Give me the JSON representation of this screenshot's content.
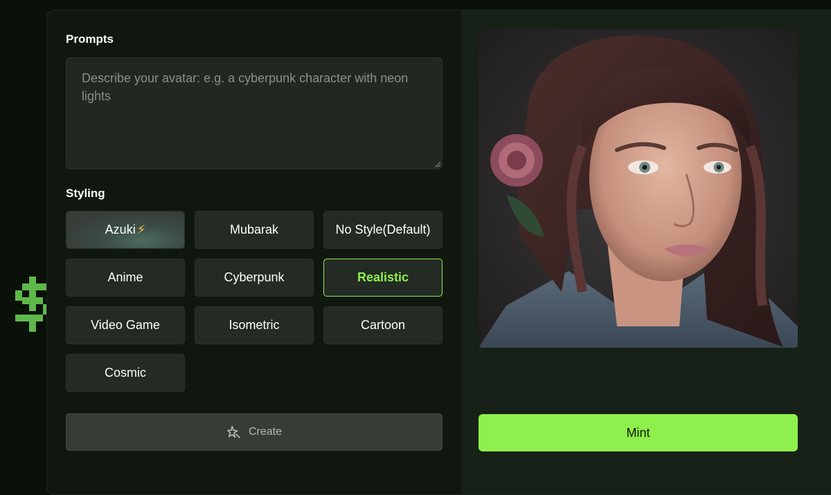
{
  "prompts": {
    "label": "Prompts",
    "placeholder": "Describe your avatar: e.g. a cyberpunk character with neon lights",
    "value": ""
  },
  "styling": {
    "label": "Styling",
    "selected": "Realistic",
    "options": [
      {
        "label": "Azuki",
        "badge_icon": "lightning-bolt-icon"
      },
      {
        "label": "Mubarak"
      },
      {
        "label": "No Style(Default)"
      },
      {
        "label": "Anime"
      },
      {
        "label": "Cyberpunk"
      },
      {
        "label": "Realistic"
      },
      {
        "label": "Video Game"
      },
      {
        "label": "Isometric"
      },
      {
        "label": "Cartoon"
      },
      {
        "label": "Cosmic"
      }
    ]
  },
  "actions": {
    "create_label": "Create",
    "create_icon": "sparkle-star-icon",
    "mint_label": "Mint"
  },
  "decorations": {
    "left_icon": "dollar-pixel-icon",
    "right_icon": "question-pixel-icon"
  },
  "colors": {
    "accent": "#8ef04c",
    "background": "#091109",
    "button": "#242b24"
  }
}
